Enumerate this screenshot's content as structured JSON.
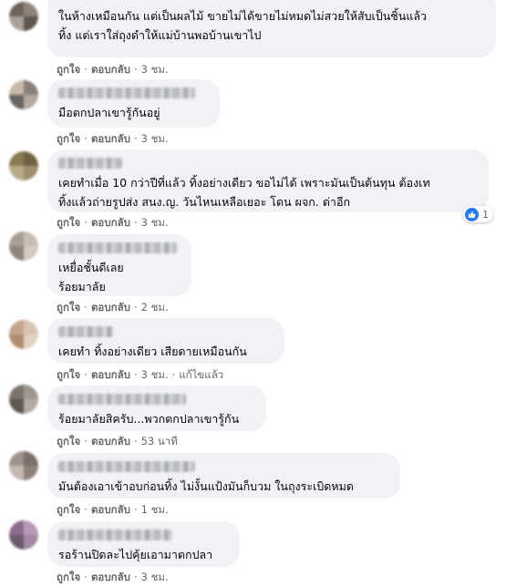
{
  "actions": {
    "like": "ถูกใจ",
    "reply": "ตอบกลับ",
    "edited": "แก้ไขแล้ว"
  },
  "comments": [
    {
      "lines": [
        "ในห้างเหมือนกัน แต่เป็นผลไม้ ขายไม่ได้ขายไม่หมดไม่สวยให้สับเป็นชิ้นแล้ว",
        "ทิ้ง แต่เราใส่ถุงดำให้แม่บ้านพอบ้านเขาไป"
      ],
      "time": "3 ชม.",
      "avatar": [
        "#6e6258",
        "#8d847c",
        "#a9a29a",
        "#5f564f"
      ]
    },
    {
      "lines": [
        "มือตกปลาเขารู้กันอยู่"
      ],
      "time": "3 ชม.",
      "avatar": [
        "#c9b8a8",
        "#8a7f79",
        "#6a6461",
        "#b5aaa0"
      ]
    },
    {
      "lines": [
        "เคยทำเมื่อ 10 กว่าปีที่แล้ว ทิ้งอย่างเดียว ขอไม่ได้ เพราะมันเป็นต้นทุน ต้องเท",
        "ทิ้งแล้วถ่ายรูปส่ง สนง.ญ. วันไหนเหลือเยอะ โดน ผจก. ด่าอีก"
      ],
      "time": "3 ชม.",
      "avatar": [
        "#8a7a52",
        "#6f6442",
        "#b8a98a",
        "#a08f6c"
      ],
      "reaction": "1"
    },
    {
      "lines": [
        "เหยื่อชั้นดีเลย",
        "ร้อยมาลัย"
      ],
      "time": "2 ชม.",
      "avatar": [
        "#a89e95",
        "#c7bdb4",
        "#8f857c",
        "#d2c9c0"
      ]
    },
    {
      "lines": [
        "เคยทำ ทิ้งอย่างเดียว เสียดายเหมือนกัน"
      ],
      "time": "3 ชม.",
      "avatar": [
        "#c4a58a",
        "#d8c3ae",
        "#b08d70",
        "#e0d2c4"
      ],
      "edited": true
    },
    {
      "lines": [
        "ร้อยมาลัยสิครับ...พวกตกปลาเขารู้กัน"
      ],
      "time": "53 นาที",
      "avatar": [
        "#7d746d",
        "#9c9590",
        "#5e5853",
        "#b3aca6"
      ]
    },
    {
      "lines": [
        "มันต้องเอาเข้าอบก่อนทิ้ง ไม่งั้นแป้งมันก็บวม ในถุงระเบิดหมด"
      ],
      "time": "1 ชม.",
      "avatar": [
        "#a0908a",
        "#7b6f6b",
        "#c5b8b0",
        "#8e827b"
      ]
    },
    {
      "lines": [
        "รอร้านปิดละไปคุ้ยเอามาตกปลา"
      ],
      "time": "3 ชม.",
      "avatar": [
        "#8e6a8f",
        "#b79bb5",
        "#6c5a70",
        "#a487a3"
      ]
    }
  ]
}
